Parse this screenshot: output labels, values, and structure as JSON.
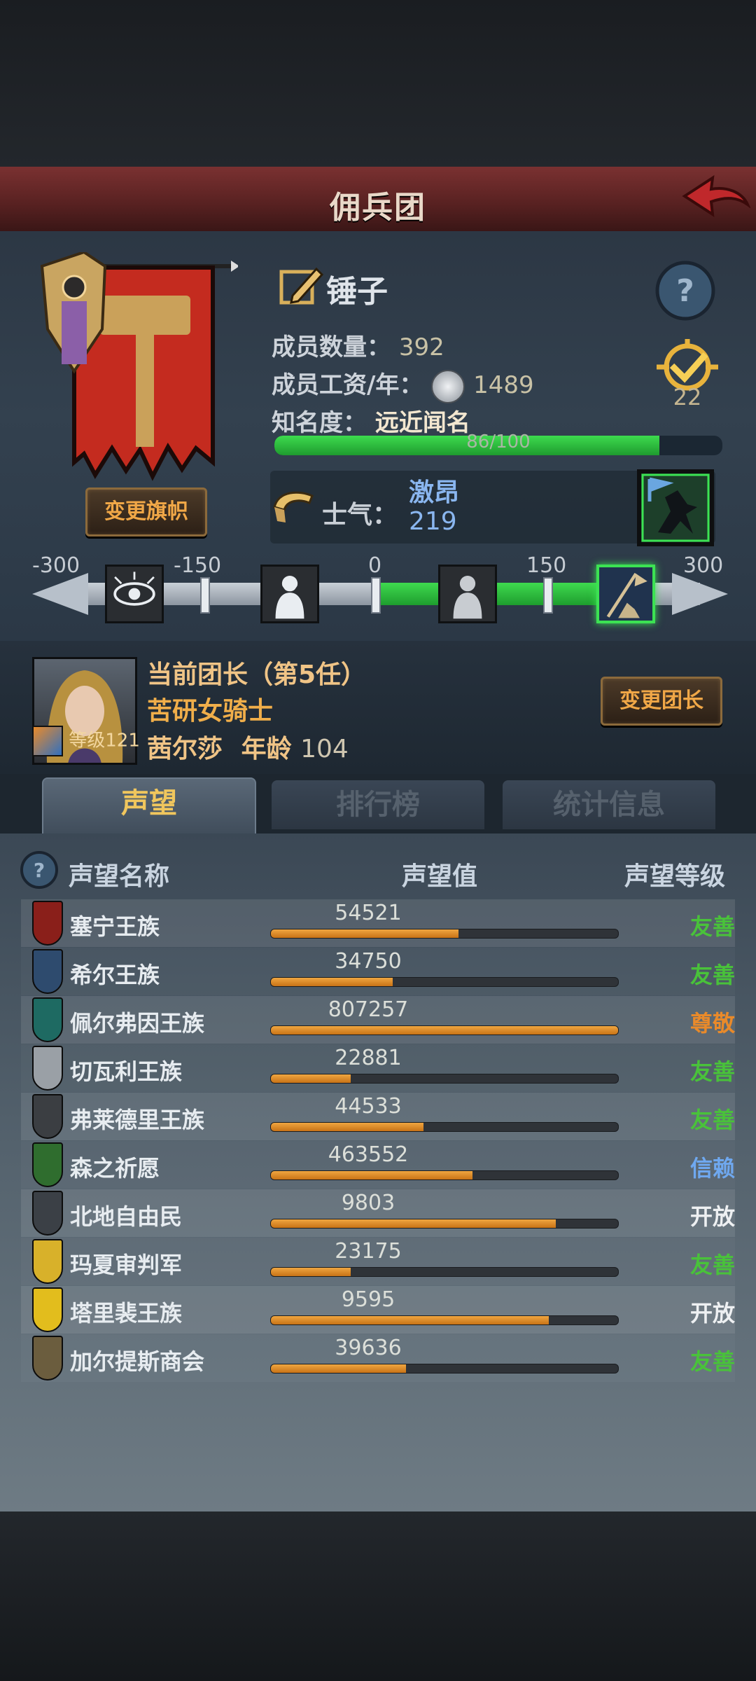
{
  "title": "佣兵团",
  "troop": {
    "name": "锤子",
    "members_label": "成员数量：",
    "members_value": "392",
    "wage_label": "成员工资/年：",
    "wage_value": "1489",
    "fame_label": "知名度：",
    "fame_value": "远近闻名",
    "fame_progress_text": "86/100",
    "fame_progress_fraction": 0.86,
    "rank_value": "22",
    "change_banner_label": "变更旗帜"
  },
  "morale": {
    "label": "士气：",
    "state": "激昂",
    "value": "219",
    "scale_labels": [
      "-300",
      "-150",
      "0",
      "150",
      "300"
    ]
  },
  "leader": {
    "title_line": "当前团长（第5任）",
    "class_line": "苦研女骑士",
    "name": "茜尔莎",
    "age_label": "年龄",
    "age_value": "104",
    "level_text": "等级121",
    "change_leader_label": "变更团长"
  },
  "tabs": [
    {
      "label": "声望",
      "active": true
    },
    {
      "label": "排行榜",
      "active": false
    },
    {
      "label": "统计信息",
      "active": false
    }
  ],
  "reputation": {
    "headers": {
      "name": "声望名称",
      "value": "声望值",
      "level": "声望等级"
    },
    "rows": [
      {
        "name": "塞宁王族",
        "value": "54521",
        "fill": 0.54,
        "level": "友善",
        "level_color": "#49c23a",
        "icon_color": "#8a1f1a"
      },
      {
        "name": "希尔王族",
        "value": "34750",
        "fill": 0.35,
        "level": "友善",
        "level_color": "#49c23a",
        "icon_color": "#2e4b6e"
      },
      {
        "name": "佩尔弗因王族",
        "value": "807257",
        "fill": 1.0,
        "level": "尊敬",
        "level_color": "#e98a2a",
        "icon_color": "#1e6a62"
      },
      {
        "name": "切瓦利王族",
        "value": "22881",
        "fill": 0.23,
        "level": "友善",
        "level_color": "#49c23a",
        "icon_color": "#9aa0a6"
      },
      {
        "name": "弗莱德里王族",
        "value": "44533",
        "fill": 0.44,
        "level": "友善",
        "level_color": "#49c23a",
        "icon_color": "#3b3e42"
      },
      {
        "name": "森之祈愿",
        "value": "463552",
        "fill": 0.58,
        "level": "信赖",
        "level_color": "#6fa8ef",
        "icon_color": "#2f6d2e"
      },
      {
        "name": "北地自由民",
        "value": "9803",
        "fill": 0.82,
        "level": "开放",
        "level_color": "#eef0f2",
        "icon_color": "#3b4046"
      },
      {
        "name": "玛夏审判军",
        "value": "23175",
        "fill": 0.23,
        "level": "友善",
        "level_color": "#49c23a",
        "icon_color": "#d8b12a"
      },
      {
        "name": "塔里裴王族",
        "value": "9595",
        "fill": 0.8,
        "level": "开放",
        "level_color": "#eef0f2",
        "icon_color": "#e2bd1d"
      },
      {
        "name": "加尔提斯商会",
        "value": "39636",
        "fill": 0.39,
        "level": "友善",
        "level_color": "#49c23a",
        "icon_color": "#6b5d3e"
      }
    ]
  }
}
